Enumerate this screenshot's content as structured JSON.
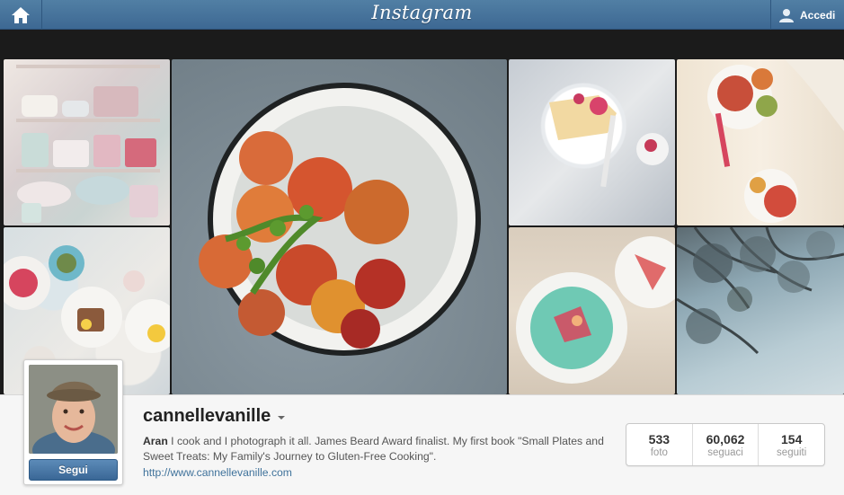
{
  "header": {
    "logo": "Instagram",
    "login_label": "Accedi"
  },
  "icons": {
    "home": "home-icon",
    "user": "user-icon",
    "dropdown": "caret-down-icon"
  },
  "profile": {
    "username": "cannellevanille",
    "follow_label": "Segui",
    "bio_name": "Aran",
    "bio_text": " I cook and I photograph it all. James Beard Award finalist. My first book \"Small Plates and Sweet Treats: My Family's Journey to Gluten-Free Cooking\".",
    "website": "http://www.cannellevanille.com"
  },
  "stats": [
    {
      "value": "533",
      "label": "foto"
    },
    {
      "value": "60,062",
      "label": "seguaci"
    },
    {
      "value": "154",
      "label": "seguiti"
    }
  ],
  "colors": {
    "header_blue": "#517fa4",
    "link_blue": "#3f729b",
    "button_blue": "#3a6796"
  }
}
